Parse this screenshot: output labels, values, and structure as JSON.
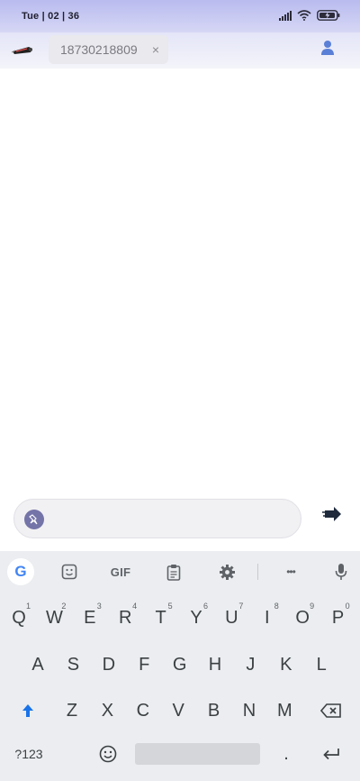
{
  "status_bar": {
    "time": "Tue | 02 | 36"
  },
  "header": {
    "contact_number": "18730218809",
    "chip_close": "×"
  },
  "composer": {
    "placeholder": "",
    "value": ""
  },
  "keyboard": {
    "toolbar": {
      "google": "G",
      "gif": "GIF",
      "more": "•••"
    },
    "row1": [
      {
        "label": "Q",
        "hint": "1"
      },
      {
        "label": "W",
        "hint": "2"
      },
      {
        "label": "E",
        "hint": "3"
      },
      {
        "label": "R",
        "hint": "4"
      },
      {
        "label": "T",
        "hint": "5"
      },
      {
        "label": "Y",
        "hint": "6"
      },
      {
        "label": "U",
        "hint": "7"
      },
      {
        "label": "I",
        "hint": "8"
      },
      {
        "label": "O",
        "hint": "9"
      },
      {
        "label": "P",
        "hint": "0"
      }
    ],
    "row2": [
      "A",
      "S",
      "D",
      "F",
      "G",
      "H",
      "J",
      "K",
      "L"
    ],
    "row3": [
      "Z",
      "X",
      "C",
      "V",
      "B",
      "N",
      "M"
    ],
    "row4": {
      "symbols": "?123",
      "period": "."
    }
  },
  "colors": {
    "status_bar": "#b9bbef",
    "accent": "#4285f4",
    "keyboard_bg": "#ebedf0"
  }
}
